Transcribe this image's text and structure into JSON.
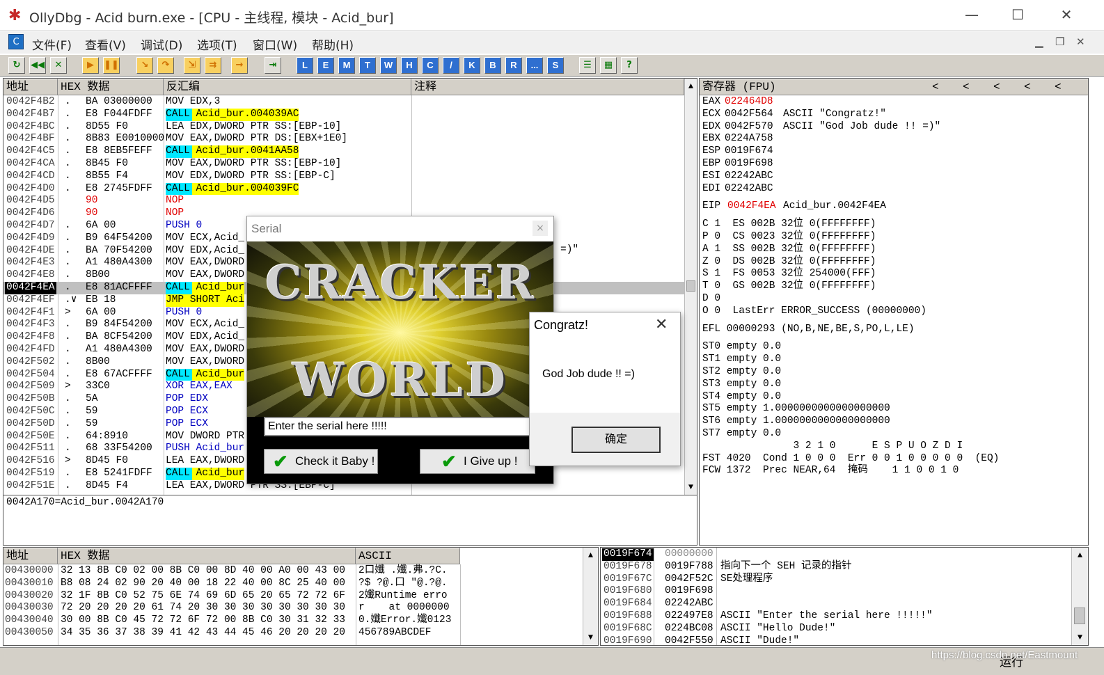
{
  "window": {
    "title": "OllyDbg - Acid burn.exe - [CPU - 主线程, 模块 - Acid_bur]",
    "min": "—",
    "max": "☐",
    "close": "✕"
  },
  "menu": [
    "文件(F)",
    "查看(V)",
    "调试(D)",
    "选项(T)",
    "窗口(W)",
    "帮助(H)"
  ],
  "toolbar_letters": [
    "L",
    "E",
    "M",
    "T",
    "W",
    "H",
    "C",
    "/",
    "K",
    "B",
    "R",
    "...",
    "S"
  ],
  "disasm": {
    "headers": {
      "addr": "地址",
      "hex": "HEX 数据",
      "asm": "反汇编",
      "comment": "注释"
    },
    "rows": [
      {
        "a": "0042F4B2",
        "m": ".",
        "h": "BA 03000000",
        "i": "MOV EDX,3"
      },
      {
        "a": "0042F4B7",
        "m": ".",
        "h": "E8 F044FDFF",
        "i": "CALL Acid_bur.004039AC"
      },
      {
        "a": "0042F4BC",
        "m": ".",
        "h": "8D55 F0",
        "i": "LEA EDX,DWORD PTR SS:[EBP-10]"
      },
      {
        "a": "0042F4BF",
        "m": ".",
        "h": "8B83 E0010000",
        "i": "MOV EAX,DWORD PTR DS:[EBX+1E0]"
      },
      {
        "a": "0042F4C5",
        "m": ".",
        "h": "E8 8EB5FEFF",
        "i": "CALL Acid_bur.0041AA58"
      },
      {
        "a": "0042F4CA",
        "m": ".",
        "h": "8B45 F0",
        "i": "MOV EAX,DWORD PTR SS:[EBP-10]"
      },
      {
        "a": "0042F4CD",
        "m": ".",
        "h": "8B55 F4",
        "i": "MOV EDX,DWORD PTR SS:[EBP-C]"
      },
      {
        "a": "0042F4D0",
        "m": ".",
        "h": "E8 2745FDFF",
        "i": "CALL Acid_bur.004039FC"
      },
      {
        "a": "0042F4D5",
        "m": "",
        "h": "90",
        "i": "NOP"
      },
      {
        "a": "0042F4D6",
        "m": "",
        "h": "90",
        "i": "NOP"
      },
      {
        "a": "0042F4D7",
        "m": ".",
        "h": "6A 00",
        "i": "PUSH 0"
      },
      {
        "a": "0042F4D9",
        "m": ".",
        "h": "B9 64F54200",
        "i": "MOV ECX,Acid_"
      },
      {
        "a": "0042F4DE",
        "m": ".",
        "h": "BA 70F54200",
        "i": "MOV EDX,Acid_"
      },
      {
        "a": "0042F4E3",
        "m": ".",
        "h": "A1 480A4300",
        "i": "MOV EAX,DWORD"
      },
      {
        "a": "0042F4E8",
        "m": ".",
        "h": "8B00",
        "i": "MOV EAX,DWORD"
      },
      {
        "a": "0042F4EA",
        "m": ".",
        "h": "E8 81ACFFFF",
        "i": "CALL Acid_bur"
      },
      {
        "a": "0042F4EF",
        "m": ".∨",
        "h": "EB 18",
        "i": "JMP SHORT Aci"
      },
      {
        "a": "0042F4F1",
        "m": ">",
        "h": "6A 00",
        "i": "PUSH 0"
      },
      {
        "a": "0042F4F3",
        "m": ".",
        "h": "B9 84F54200",
        "i": "MOV ECX,Acid_"
      },
      {
        "a": "0042F4F8",
        "m": ".",
        "h": "BA 8CF54200",
        "i": "MOV EDX,Acid_"
      },
      {
        "a": "0042F4FD",
        "m": ".",
        "h": "A1 480A4300",
        "i": "MOV EAX,DWORD"
      },
      {
        "a": "0042F502",
        "m": ".",
        "h": "8B00",
        "i": "MOV EAX,DWORD"
      },
      {
        "a": "0042F504",
        "m": ".",
        "h": "E8 67ACFFFF",
        "i": "CALL Acid_bur"
      },
      {
        "a": "0042F509",
        "m": ">",
        "h": "33C0",
        "i": "XOR EAX,EAX"
      },
      {
        "a": "0042F50B",
        "m": ".",
        "h": "5A",
        "i": "POP EDX"
      },
      {
        "a": "0042F50C",
        "m": ".",
        "h": "59",
        "i": "POP ECX"
      },
      {
        "a": "0042F50D",
        "m": ".",
        "h": "59",
        "i": "POP ECX"
      },
      {
        "a": "0042F50E",
        "m": ".",
        "h": "64:8910",
        "i": "MOV DWORD PTR"
      },
      {
        "a": "0042F511",
        "m": ".",
        "h": "68 33F54200",
        "i": "PUSH Acid_bur"
      },
      {
        "a": "0042F516",
        "m": ">",
        "h": "8D45 F0",
        "i": "LEA EAX,DWORD"
      },
      {
        "a": "0042F519",
        "m": ".",
        "h": "E8 5241FDFF",
        "i": "CALL Acid_bur"
      },
      {
        "a": "0042F51E",
        "m": ".",
        "h": "8D45 F4",
        "i": "LEA EAX,DWORD PTR SS:[EBP-C]"
      }
    ],
    "comment_visible": "=)\"",
    "info": "0042A170=Acid_bur.0042A170"
  },
  "registers": {
    "header": "寄存器 (FPU)",
    "arrows": [
      "<",
      "<",
      "<",
      "<",
      "<"
    ],
    "gp": [
      {
        "n": "EAX",
        "v": "022464D8",
        "x": ""
      },
      {
        "n": "ECX",
        "v": "0042F564",
        "x": "ASCII \"Congratz!\""
      },
      {
        "n": "EDX",
        "v": "0042F570",
        "x": "ASCII \"God Job dude !! =)\""
      },
      {
        "n": "EBX",
        "v": "0224A758",
        "x": ""
      },
      {
        "n": "ESP",
        "v": "0019F674",
        "x": ""
      },
      {
        "n": "EBP",
        "v": "0019F698",
        "x": ""
      },
      {
        "n": "ESI",
        "v": "02242ABC",
        "x": ""
      },
      {
        "n": "EDI",
        "v": "02242ABC",
        "x": ""
      }
    ],
    "eip": {
      "n": "EIP",
      "v": "0042F4EA",
      "x": "Acid_bur.0042F4EA"
    },
    "flags": [
      "C 1  ES 002B 32位 0(FFFFFFFF)",
      "P 0  CS 0023 32位 0(FFFFFFFF)",
      "A 1  SS 002B 32位 0(FFFFFFFF)",
      "Z 0  DS 002B 32位 0(FFFFFFFF)",
      "S 1  FS 0053 32位 254000(FFF)",
      "T 0  GS 002B 32位 0(FFFFFFFF)",
      "D 0",
      "O 0  LastErr ERROR_SUCCESS (00000000)"
    ],
    "efl": "EFL 00000293 (NO,B,NE,BE,S,PO,L,LE)",
    "fpu": [
      "ST0 empty 0.0",
      "ST1 empty 0.0",
      "ST2 empty 0.0",
      "ST3 empty 0.0",
      "ST4 empty 0.0",
      "ST5 empty 1.0000000000000000000",
      "ST6 empty 1.0000000000000000000",
      "ST7 empty 0.0"
    ],
    "fst_hdr": "               3 2 1 0      E S P U O Z D I",
    "fst": "FST 4020  Cond 1 0 0 0  Err 0 0 1 0 0 0 0 0  (EQ)",
    "fcw": "FCW 1372  Prec NEAR,64  掩码    1 1 0 0 1 0"
  },
  "dump": {
    "headers": {
      "addr": "地址",
      "hex": "HEX 数据",
      "ascii": "ASCII"
    },
    "rows": [
      {
        "a": "00430000",
        "h": "32 13 8B C0 02 00 8B C0 00 8D 40 00 A0 00 43 00",
        "s": "2口孅 .孅.弗.?C."
      },
      {
        "a": "00430010",
        "h": "B8 08 24 02 90 20 40 00 18 22 40 00 8C 25 40 00",
        "s": "?$ ?@.口 \"@.?@."
      },
      {
        "a": "00430020",
        "h": "32 1F 8B C0 52 75 6E 74 69 6D 65 20 65 72 72 6F",
        "s": "2孅Runtime erro"
      },
      {
        "a": "00430030",
        "h": "72 20 20 20 20 61 74 20 30 30 30 30 30 30 30 30",
        "s": "r    at 0000000"
      },
      {
        "a": "00430040",
        "h": "30 00 8B C0 45 72 72 6F 72 00 8B C0 30 31 32 33",
        "s": "0.孅Error.孅0123"
      },
      {
        "a": "00430050",
        "h": "34 35 36 37 38 39 41 42 43 44 45 46 20 20 20 20",
        "s": "456789ABCDEF"
      }
    ]
  },
  "stack": {
    "rows": [
      {
        "a": "0019F674",
        "v": "00000000",
        "c": ""
      },
      {
        "a": "0019F678",
        "v": "0019F788",
        "c": "指向下一个 SEH 记录的指针"
      },
      {
        "a": "0019F67C",
        "v": "0042F52C",
        "c": "SE处理程序"
      },
      {
        "a": "0019F680",
        "v": "0019F698",
        "c": ""
      },
      {
        "a": "0019F684",
        "v": "02242ABC",
        "c": ""
      },
      {
        "a": "0019F688",
        "v": "022497E8",
        "c": "ASCII \"Enter the serial here !!!!!\""
      },
      {
        "a": "0019F68C",
        "v": "0224BC08",
        "c": "ASCII \"Hello Dude!\""
      },
      {
        "a": "0019F690",
        "v": "0042F550",
        "c": "ASCII \"Dude!\""
      }
    ]
  },
  "serial_dialog": {
    "title": "Serial",
    "close": "×",
    "logo_top": "CRACKER",
    "logo_bottom": "WORLD",
    "input": "Enter the serial here !!!!!",
    "check_btn": "Check it Baby !",
    "give_btn": "I Give up !"
  },
  "msgbox": {
    "title": "Congratz!",
    "close": "✕",
    "message": "God Job dude !! =)",
    "ok": "确定"
  },
  "status": {
    "state": "运行",
    "watermark": "https://blog.csdn.net/Eastmount"
  }
}
